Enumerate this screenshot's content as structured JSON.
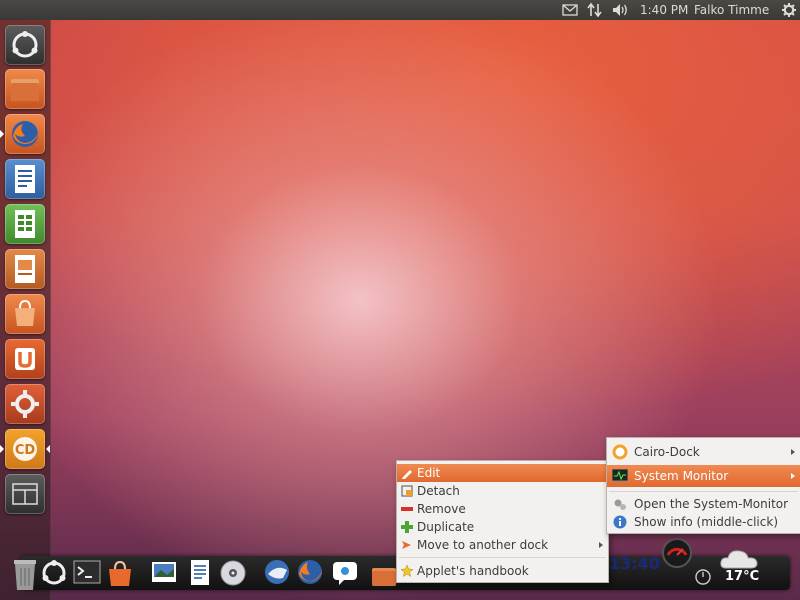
{
  "top_panel": {
    "time": "1:40 PM",
    "user": "Falko Timme",
    "icons": [
      "mail-icon",
      "network-arrows-icon",
      "volume-icon",
      "gear-icon"
    ]
  },
  "launcher": {
    "items": [
      "dash-home-icon",
      "files-folder-icon",
      "firefox-icon",
      "writer-icon",
      "calc-icon",
      "impress-icon",
      "software-center-icon",
      "ubuntu-one-icon",
      "system-settings-icon",
      "cairo-dock-icon",
      "workspace-switcher-icon"
    ]
  },
  "dock": {
    "clock": "13:40",
    "weather_temp": "17°C",
    "icons": [
      "trash-icon",
      "ubuntu-logo-icon",
      "terminal-icon",
      "shopping-bag-icon",
      "image-viewer-icon",
      "document-icon",
      "cd-icon",
      "thunderbird-icon",
      "firefox-icon",
      "chat-icon",
      "folder-icon",
      "system-monitor-gauge-icon",
      "clock-icon",
      "weather-cloud-icon"
    ]
  },
  "context_menu": {
    "items": [
      {
        "label": "Edit",
        "icon": "pencil-icon"
      },
      {
        "label": "Detach",
        "icon": "detach-icon"
      },
      {
        "label": "Remove",
        "icon": "remove-icon"
      },
      {
        "label": "Duplicate",
        "icon": "plus-icon"
      },
      {
        "label": "Move to another dock",
        "icon": "move-icon"
      },
      {
        "label": "Applet's handbook",
        "icon": "star-icon"
      }
    ]
  },
  "submenu": {
    "items": [
      {
        "label": "Cairo-Dock",
        "icon": "cairo-dock-icon"
      },
      {
        "label": "System Monitor",
        "icon": "monitor-icon"
      },
      {
        "label": "Open the System-Monitor",
        "icon": "gears-icon"
      },
      {
        "label": "Show info (middle-click)",
        "icon": "info-icon"
      }
    ]
  },
  "colors": {
    "accent": "#e86a33",
    "panel": "#3c3b37"
  }
}
